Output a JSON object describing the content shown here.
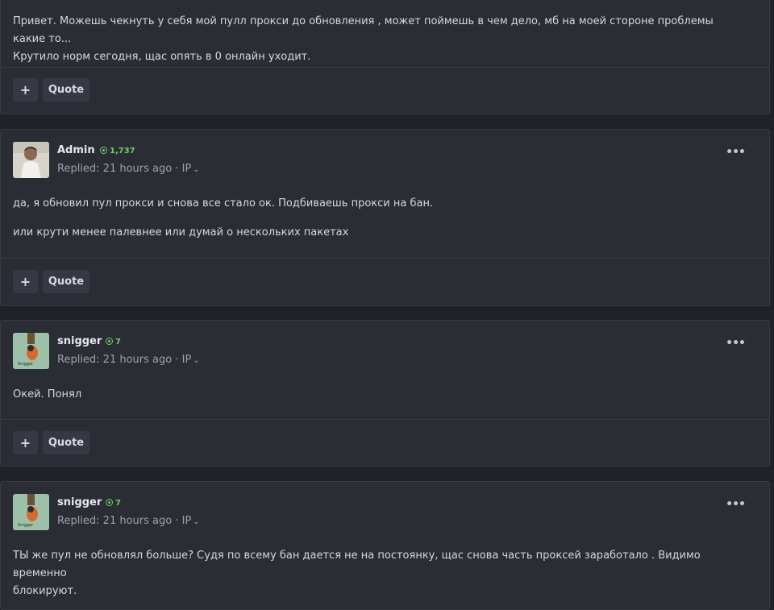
{
  "posts": [
    {
      "body": [
        "Привет. Можешь чекнуть у себя мой пулл прокси до обновления , может поймешь в чем дело, мб на моей стороне проблемы какие то...",
        "Крутило норм сегодня, щас опять в 0 онлайн уходит."
      ],
      "quote_label": "Quote"
    },
    {
      "author": "Admin",
      "rep": "1,737",
      "meta": "Replied: 21 hours ago · IP",
      "body": [
        "да, я обновил пул прокси и снова все стало ок. Подбиваешь прокси на бан.",
        "или крути менее палевнее или думай о нескольких пакетах"
      ],
      "quote_label": "Quote"
    },
    {
      "author": "snigger",
      "rep": "7",
      "meta": "Replied: 21 hours ago · IP",
      "body": [
        "Окей. Понял"
      ],
      "quote_label": "Quote"
    },
    {
      "author": "snigger",
      "rep": "7",
      "meta": "Replied: 21 hours ago · IP",
      "body": [
        "ТЫ же пул не обновлял больше? Судя по всему бан дается не на постоянку, щас снова часть проксей заработало . Видимо временно",
        "блокируют."
      ]
    }
  ],
  "icons": {
    "plus": "+",
    "more": "•••",
    "chevron": "⌄",
    "rep": "plus-circle-icon"
  },
  "colors": {
    "background": "#202228",
    "post_bg": "#2b2d35",
    "rep_green": "#6ccf63",
    "button_bg": "#363944"
  }
}
